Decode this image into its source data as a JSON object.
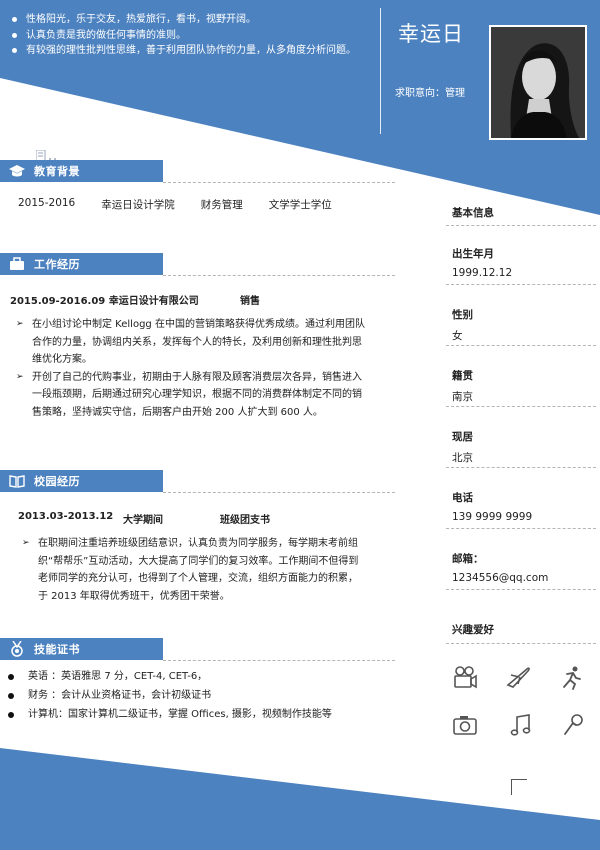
{
  "header": {
    "intro": [
      "性格阳光，乐于交友，热爱旅行，看书，视野开阔。",
      "认真负责是我的做任何事情的准则。",
      "有较强的理性批判性思维，善于利用团队协作的力量，从多角度分析问题。"
    ],
    "name": "幸运日",
    "intent": "求职意向：管理"
  },
  "education": {
    "title": "教育背景",
    "period": "2015-2016",
    "school": "幸运日设计学院",
    "major": "财务管理",
    "degree": "文学学士学位"
  },
  "work": {
    "title": "工作经历",
    "headline": "2015.09-2016.09 幸运日设计有限公司",
    "position": "销售",
    "items": [
      "在小组讨论中制定 Kellogg 在中国的营销策略获得优秀成绩。通过利用团队合作的力量，协调组内关系，发挥每个人的特长，及利用创新和理性批判思维优化方案。",
      "开创了自己的代购事业，初期由于人脉有限及顾客消费层次各异，销售进入一段瓶颈期，后期通过研究心理学知识，根据不同的消费群体制定不同的销售策略，坚持诚实守信，后期客户由开始 200 人扩大到 600 人。"
    ]
  },
  "campus": {
    "title": "校园经历",
    "period": "2013.03-2013.12",
    "org": "大学期间",
    "role": "班级团支书",
    "items": [
      "在职期间注重培养班级团结意识，认真负责为同学服务，每学期末考前组织“帮帮乐”互动活动，大大提高了同学们的复习效率。工作期间不但得到老师同学的充分认可，也得到了个人管理，交流，组织方面能力的积累，于 2013 年取得优秀班干，优秀团干荣誉。"
    ]
  },
  "skills": {
    "title": "技能证书",
    "items": [
      "英语  ：英语雅思 7 分，CET-4, CET-6，",
      "财务  ：会计从业资格证书，会计初级证书",
      "计算机：国家计算机二级证书，掌握 Offices, 摄影，视频制作技能等"
    ]
  },
  "basic": {
    "title": "基本信息",
    "birth_label": "出生年月",
    "birth": "1999.12.12",
    "gender_label": "性别",
    "gender": "女",
    "native_label": "籍贯",
    "native": "南京",
    "residence_label": "现居",
    "residence": "北京",
    "phone_label": "电话",
    "phone": "139 9999 9999",
    "email_label": "邮箱：",
    "email": "1234556@qq.com"
  },
  "hobbies": {
    "title": "兴趣爱好",
    "icons": [
      "film-camera-icon",
      "airplane-icon",
      "running-icon",
      "photo-camera-icon",
      "music-note-icon",
      "microphone-icon"
    ]
  },
  "colors": {
    "accent": "#4d82c0",
    "text": "#222222",
    "divider": "#b5b5b5"
  }
}
